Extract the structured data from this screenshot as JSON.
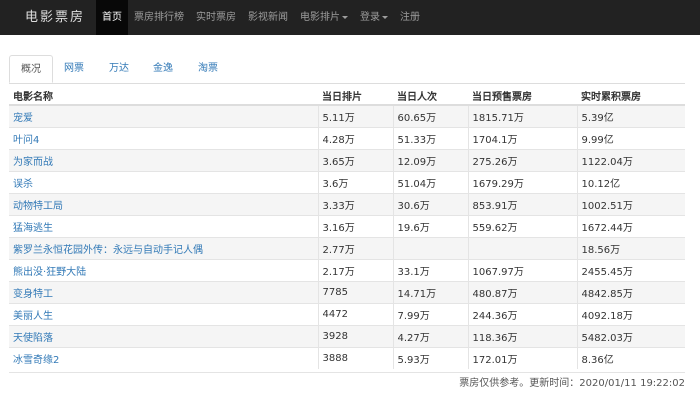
{
  "navbar": {
    "brand": "电影票房",
    "items": [
      {
        "label": "首页",
        "active": true,
        "dropdown": false
      },
      {
        "label": "票房排行榜",
        "active": false,
        "dropdown": false
      },
      {
        "label": "实时票房",
        "active": false,
        "dropdown": false
      },
      {
        "label": "影视新闻",
        "active": false,
        "dropdown": false
      },
      {
        "label": "电影排片",
        "active": false,
        "dropdown": true
      },
      {
        "label": "登录",
        "active": false,
        "dropdown": true
      },
      {
        "label": "注册",
        "active": false,
        "dropdown": false
      }
    ]
  },
  "tabs": [
    {
      "label": "概况",
      "active": true
    },
    {
      "label": "网票",
      "active": false
    },
    {
      "label": "万达",
      "active": false
    },
    {
      "label": "金逸",
      "active": false
    },
    {
      "label": "淘票",
      "active": false
    }
  ],
  "table": {
    "headers": [
      "电影名称",
      "当日排片",
      "当日人次",
      "当日预售票房",
      "实时累积票房"
    ],
    "rows": [
      [
        "宠爱",
        "5.11万",
        "60.65万",
        "1815.71万",
        "5.39亿"
      ],
      [
        "叶问4",
        "4.28万",
        "51.33万",
        "1704.1万",
        "9.99亿"
      ],
      [
        "为家而战",
        "3.65万",
        "12.09万",
        "275.26万",
        "1122.04万"
      ],
      [
        "误杀",
        "3.6万",
        "51.04万",
        "1679.29万",
        "10.12亿"
      ],
      [
        "动物特工局",
        "3.33万",
        "30.6万",
        "853.91万",
        "1002.51万"
      ],
      [
        "猛海逃生",
        "3.16万",
        "19.6万",
        "559.62万",
        "1672.44万"
      ],
      [
        "紫罗兰永恒花园外传：永远与自动手记人偶",
        "2.77万",
        "",
        "",
        "18.56万"
      ],
      [
        "熊出没·狂野大陆",
        "2.17万",
        "33.1万",
        "1067.97万",
        "2455.45万"
      ],
      [
        "变身特工",
        "7785",
        "14.71万",
        "480.87万",
        "4842.85万"
      ],
      [
        "美丽人生",
        "4472",
        "7.99万",
        "244.36万",
        "4092.18万"
      ],
      [
        "天使陷落",
        "3928",
        "4.27万",
        "118.36万",
        "5482.03万"
      ],
      [
        "冰雪奇缘2",
        "3888",
        "5.93万",
        "172.01万",
        "8.36亿"
      ]
    ]
  },
  "footer": {
    "note": "票房仅供参考。更新时间：2020/01/11 19:22:02"
  }
}
